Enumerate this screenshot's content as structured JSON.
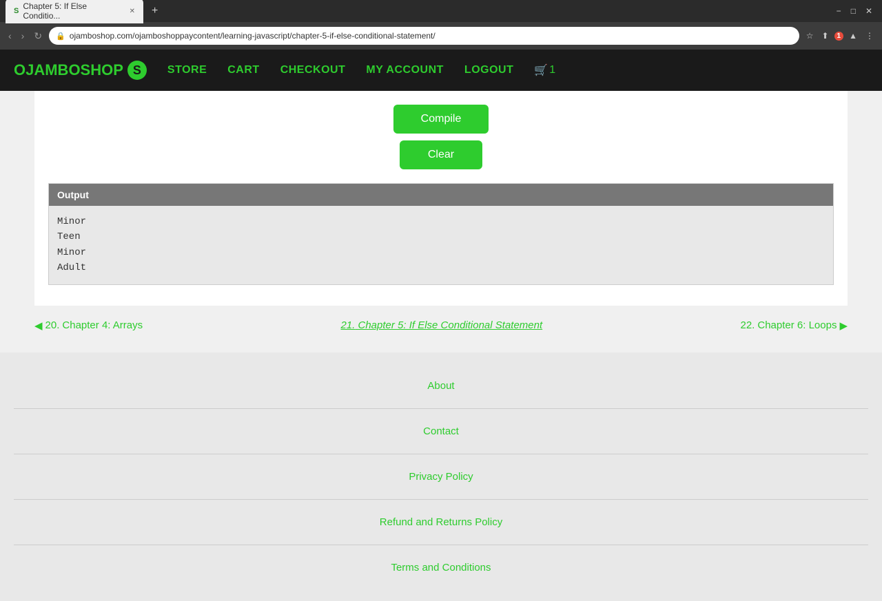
{
  "browser": {
    "tab_title": "Chapter 5: If Else Conditio...",
    "tab_icon": "S",
    "url": "ojamboshop.com/ojamboshoppaycontent/learning-javascript/chapter-5-if-else-conditional-statement/",
    "new_tab_label": "+",
    "nav_back": "‹",
    "nav_forward": "›",
    "nav_reload": "↻",
    "window_controls": [
      "−",
      "□",
      "✕"
    ]
  },
  "navbar": {
    "brand": "OJAMBOSHOP",
    "brand_s": "S",
    "links": [
      {
        "label": "STORE",
        "name": "store-link"
      },
      {
        "label": "CART",
        "name": "cart-link"
      },
      {
        "label": "CHECKOUT",
        "name": "checkout-link"
      },
      {
        "label": "MY ACCOUNT",
        "name": "my-account-link"
      },
      {
        "label": "LOGOUT",
        "name": "logout-link"
      }
    ],
    "cart_icon": "🛒",
    "cart_count": "1"
  },
  "main": {
    "compile_button": "Compile",
    "clear_button": "Clear",
    "output_header": "Output",
    "output_lines": [
      "Minor",
      "Teen",
      "Minor",
      "Adult"
    ]
  },
  "chapter_nav": {
    "prev_number": "20.",
    "prev_label": "Chapter 4: Arrays",
    "current_number": "21.",
    "current_label": "Chapter 5: If Else Conditional Statement",
    "next_number": "22.",
    "next_label": "Chapter 6: Loops"
  },
  "footer": {
    "links": [
      {
        "label": "About",
        "name": "about-link"
      },
      {
        "label": "Contact",
        "name": "contact-link"
      },
      {
        "label": "Privacy Policy",
        "name": "privacy-policy-link"
      },
      {
        "label": "Refund and Returns Policy",
        "name": "refund-policy-link"
      },
      {
        "label": "Terms and Conditions",
        "name": "terms-link"
      }
    ]
  }
}
